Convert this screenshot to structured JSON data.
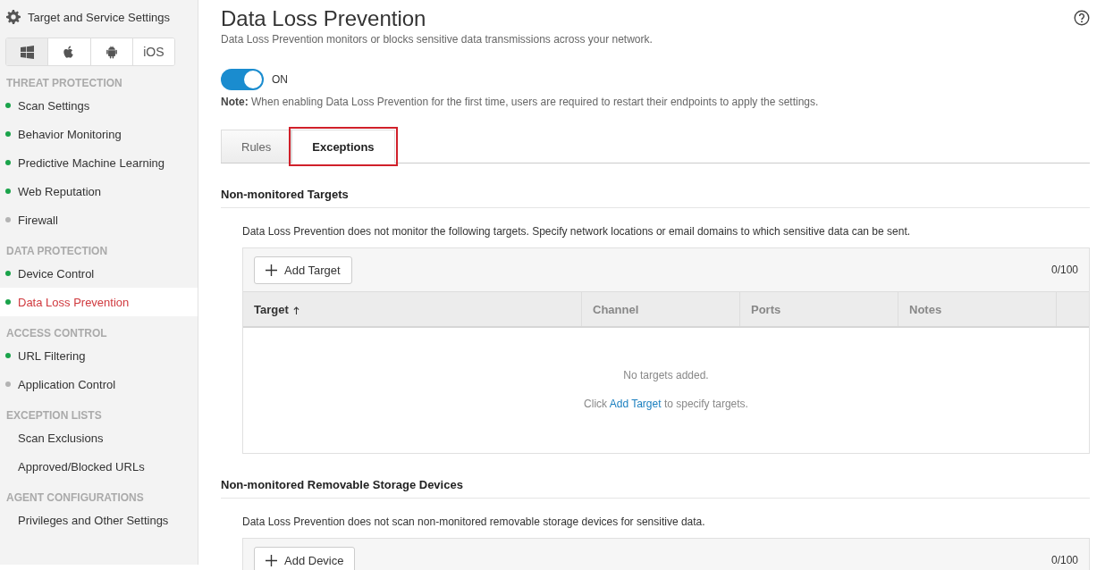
{
  "sidebar": {
    "title": "Target and Service Settings",
    "platforms": [
      {
        "kind": "windows",
        "selected": true
      },
      {
        "kind": "apple",
        "selected": false
      },
      {
        "kind": "android",
        "selected": false
      },
      {
        "kind": "text",
        "label": "iOS",
        "selected": false
      }
    ],
    "groups": [
      {
        "heading": "THREAT PROTECTION",
        "items": [
          {
            "label": "Scan Settings",
            "color": "#1aa34a",
            "selected": false
          },
          {
            "label": "Behavior Monitoring",
            "color": "#1aa34a",
            "selected": false
          },
          {
            "label": "Predictive Machine Learning",
            "color": "#1aa34a",
            "selected": false
          },
          {
            "label": "Web Reputation",
            "color": "#1aa34a",
            "selected": false
          },
          {
            "label": "Firewall",
            "color": "#b3b3b3",
            "selected": false
          }
        ]
      },
      {
        "heading": "DATA PROTECTION",
        "items": [
          {
            "label": "Device Control",
            "color": "#1aa34a",
            "selected": false
          },
          {
            "label": "Data Loss Prevention",
            "color": "#1aa34a",
            "selected": true
          }
        ]
      },
      {
        "heading": "ACCESS CONTROL",
        "items": [
          {
            "label": "URL Filtering",
            "color": "#1aa34a",
            "selected": false
          },
          {
            "label": "Application Control",
            "color": "#b3b3b3",
            "selected": false
          }
        ]
      },
      {
        "heading": "EXCEPTION LISTS",
        "items": [
          {
            "label": "Scan Exclusions",
            "selected": false
          },
          {
            "label": "Approved/Blocked URLs",
            "selected": false
          }
        ]
      },
      {
        "heading": "AGENT CONFIGURATIONS",
        "items": [
          {
            "label": "Privileges and Other Settings",
            "selected": false
          }
        ]
      }
    ]
  },
  "main": {
    "title": "Data Loss Prevention",
    "subtitle": "Data Loss Prevention monitors or blocks sensitive data transmissions across your network.",
    "toggle": {
      "on": true,
      "label": "ON"
    },
    "note": "**Note:** When enabling Data Loss Prevention for the first time, users are required to restart their endpoints to apply the settings.",
    "tabs": [
      {
        "label": "Rules",
        "selected": false,
        "highlighted": false
      },
      {
        "label": "Exceptions",
        "selected": true,
        "highlighted": true
      }
    ],
    "sections": [
      {
        "heading": "Non-monitored Targets",
        "description": "Data Loss Prevention does not monitor the following targets. Specify network locations or email domains to which sensitive data can be sent.",
        "add_button": "Add Target",
        "count": "0/100",
        "table": {
          "columns": [
            {
              "label": "Target",
              "sorted": true
            },
            {
              "label": "Channel",
              "sorted": false
            },
            {
              "label": "Ports",
              "sorted": false
            },
            {
              "label": "Notes",
              "sorted": false
            }
          ],
          "empty_text": "No targets added.",
          "hint_before": "Click",
          "hint_link": "Add Target",
          "hint_after": "to specify targets."
        }
      },
      {
        "heading": "Non-monitored Removable Storage Devices",
        "description": "Data Loss Prevention does not scan non-monitored removable storage devices for sensitive data.",
        "add_button": "Add Device",
        "count": "0/100"
      }
    ]
  }
}
